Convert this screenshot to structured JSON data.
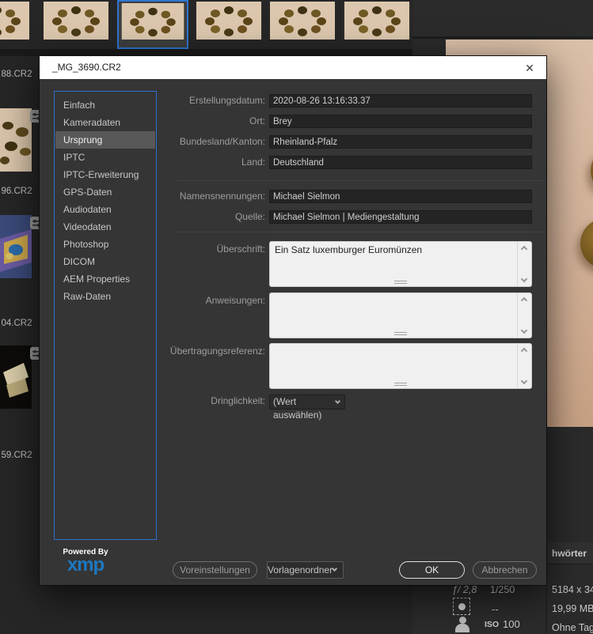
{
  "window": {
    "title": "_MG_3690.CR2"
  },
  "icons": {
    "close": "✕"
  },
  "sidebar": {
    "items": [
      {
        "label": "Einfach",
        "selected": false
      },
      {
        "label": "Kameradaten",
        "selected": false
      },
      {
        "label": "Ursprung",
        "selected": true
      },
      {
        "label": "IPTC",
        "selected": false
      },
      {
        "label": "IPTC-Erweiterung",
        "selected": false
      },
      {
        "label": "GPS-Daten",
        "selected": false
      },
      {
        "label": "Audiodaten",
        "selected": false
      },
      {
        "label": "Videodaten",
        "selected": false
      },
      {
        "label": "Photoshop",
        "selected": false
      },
      {
        "label": "DICOM",
        "selected": false
      },
      {
        "label": "AEM Properties",
        "selected": false
      },
      {
        "label": "Raw-Daten",
        "selected": false
      }
    ]
  },
  "origin_fields": [
    {
      "label": "Erstellungsdatum:",
      "value": "2020-08-26 13:16:33.37"
    },
    {
      "label": "Ort:",
      "value": "Brey"
    },
    {
      "label": "Bundesland/Kanton:",
      "value": "Rheinland-Pfalz"
    },
    {
      "label": "Land:",
      "value": "Deutschland"
    }
  ],
  "credit_fields": [
    {
      "label": "Namensnennungen:",
      "value": "Michael Sielmon"
    },
    {
      "label": "Quelle:",
      "value": "Michael Sielmon | Mediengestaltung"
    }
  ],
  "textareas": [
    {
      "label": "Überschrift:",
      "value": "Ein Satz luxemburger Euromünzen"
    },
    {
      "label": "Anweisungen:",
      "value": ""
    },
    {
      "label": "Übertragungsreferenz:",
      "value": ""
    }
  ],
  "urgency": {
    "label": "Dringlichkeit:",
    "value": "(Wert auswählen)"
  },
  "footer": {
    "powered_by": "Powered By",
    "logo_text": "xmp",
    "presets_button": "Voreinstellungen",
    "template_folder_button": "Vorlagenordner",
    "ok_button": "OK",
    "cancel_button": "Abbrechen"
  },
  "browser": {
    "left_file_labels": [
      "88.CR2",
      "96.CR2",
      "04.CR2",
      "59.CR2"
    ]
  },
  "metadata_panel": {
    "tab_label_partial": "hwörter",
    "placard": {
      "aperture": "ƒ/ 2,8",
      "shutter": "1/250",
      "metering_value": "--",
      "iso_label": "ISO",
      "iso_value": "100"
    },
    "values": [
      "5184 x 34",
      "19,99 MB",
      "Ohne Tag"
    ]
  },
  "colors": {
    "accent_blue": "#2f76d2",
    "xmp_blue": "#1d78c1",
    "preview_beige": "#d2b198",
    "dialog_bg": "#353535"
  }
}
